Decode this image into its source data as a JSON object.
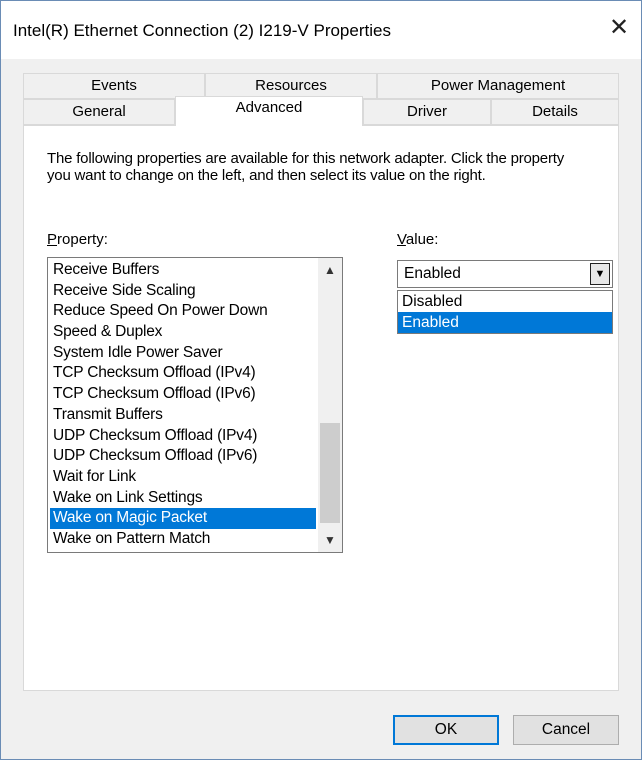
{
  "window": {
    "title": "Intel(R) Ethernet Connection (2) I219-V Properties",
    "close_symbol": "✕"
  },
  "tabs": {
    "row1": [
      "Events",
      "Resources",
      "Power Management"
    ],
    "row2": [
      "General",
      "Advanced",
      "Driver",
      "Details"
    ],
    "selected": "Advanced"
  },
  "advanced": {
    "description": "The following properties are available for this network adapter. Click the property you want to change on the left, and then select its value on the right.",
    "property_label_accel": "P",
    "property_label_rest": "roperty:",
    "value_label_accel": "V",
    "value_label_rest": "alue:",
    "properties": [
      "Receive Buffers",
      "Receive Side Scaling",
      "Reduce Speed On Power Down",
      "Speed & Duplex",
      "System Idle Power Saver",
      "TCP Checksum Offload (IPv4)",
      "TCP Checksum Offload (IPv6)",
      "Transmit Buffers",
      "UDP Checksum Offload (IPv4)",
      "UDP Checksum Offload (IPv6)",
      "Wait for Link",
      "Wake on Link Settings",
      "Wake on Magic Packet",
      "Wake on Pattern Match"
    ],
    "selected_property": "Wake on Magic Packet",
    "value": {
      "current": "Enabled",
      "options": [
        "Disabled",
        "Enabled"
      ],
      "highlighted": "Enabled"
    }
  },
  "buttons": {
    "ok": "OK",
    "cancel": "Cancel"
  },
  "colors": {
    "selection": "#0078d7",
    "dialog_bg": "#f0f0f0"
  }
}
